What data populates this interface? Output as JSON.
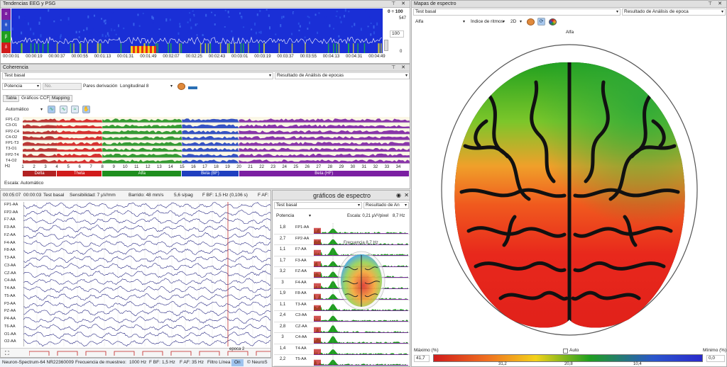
{
  "eeg_trends": {
    "title": "Tendencias EEG y PSG",
    "range_label": "0 ÷ 100",
    "scale_top": "547",
    "scale_value": "100",
    "scale_bottom": "0",
    "channels": [
      "α",
      "θ",
      "β",
      "δ"
    ],
    "time_labels": [
      "00:00:01",
      "00:00:19",
      "00:00:37",
      "00:00:55",
      "00:01:13",
      "00:01:31",
      "00:01:49",
      "00:02:07",
      "00:02:25",
      "00:02:43",
      "00:03:01",
      "00:03:19",
      "00:03:37",
      "00:03:55",
      "00:04:13",
      "00:04:31",
      "00:04:49"
    ]
  },
  "coherence": {
    "title": "Coherencia",
    "state_select": "Test basal",
    "result_select": "Resultado de Análisis de epocas",
    "measure_select": "Potencia",
    "no_input": "No.",
    "pairs_label": "Pares derivación:",
    "pairs_value": "Longitudinal 8",
    "tabs": [
      "Tabla",
      "Gráficos CCF",
      "Mapping"
    ],
    "auto_select": "Automático",
    "channels": [
      "FP1-C3",
      "C3-O1",
      "FP2-C4",
      "C4-O2",
      "FP1-T3",
      "T3-O1",
      "FP2-T4",
      "T4-O2"
    ],
    "hz_label": "Hz",
    "hz_ticks": [
      "1",
      "2",
      "3",
      "4",
      "5",
      "6",
      "7",
      "8",
      "9",
      "10",
      "11",
      "12",
      "13",
      "14",
      "15",
      "16",
      "17",
      "18",
      "19",
      "20",
      "21",
      "22",
      "23",
      "24",
      "25",
      "26",
      "27",
      "28",
      "29",
      "30",
      "31",
      "32",
      "33",
      "34"
    ],
    "bands": [
      {
        "name": "Delta",
        "color": "#b22222",
        "from": 1,
        "to": 4
      },
      {
        "name": "Theta",
        "color": "#d11b1b",
        "from": 4,
        "to": 8
      },
      {
        "name": "Alfa",
        "color": "#1f8f1f",
        "from": 8,
        "to": 15
      },
      {
        "name": "Beta (BF)",
        "color": "#1f3fbf",
        "from": 15,
        "to": 20
      },
      {
        "name": "Beta (HF)",
        "color": "#7b1fa2",
        "from": 20,
        "to": 35
      }
    ],
    "scale_text": "Escala: Automático"
  },
  "eeg_view": {
    "time_a": "00:05:07",
    "time_b": "00:00:03",
    "state": "Test basal",
    "sensitivity": "Sensibilidad: 7 µV/mm",
    "sweep": "Barrido: 48 mm/s",
    "page": "5,6 s/pag",
    "fbf": "F BF: 1,5 Hz (0,106 s)",
    "faf": "F AF:",
    "channels": [
      "FP1-AA",
      "FP2-AA",
      "F7-AA",
      "F3-AA",
      "FZ-AA",
      "F4-AA",
      "F8-AA",
      "T3-AA",
      "C3-AA",
      "CZ-AA",
      "C4-AA",
      "T4-AA",
      "T5-AA",
      "P3-AA",
      "PZ-AA",
      "P4-AA",
      "T6-AA",
      "O1-AA",
      "O2-AA"
    ],
    "epoch_label": "epoca 2"
  },
  "spectrum_graphs": {
    "title": "gráficos de espectro",
    "state": "Test basal",
    "result": "Resultado de An",
    "measure": "Potencia",
    "scale": "Escala: 0,21 µV²/pixel",
    "freq_value": "8,7 Hz",
    "freq_annot": "Frecuencia 8,7 Hz",
    "rows": [
      {
        "value": "1,8",
        "ch": "FP1-AA"
      },
      {
        "value": "2,7",
        "ch": "FP2-AA"
      },
      {
        "value": "1,1",
        "ch": "F7-AA"
      },
      {
        "value": "1,7",
        "ch": "F3-AA"
      },
      {
        "value": "3,2",
        "ch": "FZ-AA"
      },
      {
        "value": "3",
        "ch": "F4-AA"
      },
      {
        "value": "1,9",
        "ch": "F8-AA"
      },
      {
        "value": "1,1",
        "ch": "T3-AA"
      },
      {
        "value": "2,4",
        "ch": "C3-AA"
      },
      {
        "value": "2,8",
        "ch": "CZ-AA"
      },
      {
        "value": "3",
        "ch": "C4-AA"
      },
      {
        "value": "1,4",
        "ch": "T4-AA"
      },
      {
        "value": "2,2",
        "ch": "T5-AA"
      }
    ]
  },
  "spectrum_map": {
    "title": "Mapas de espectro",
    "state": "Test basal",
    "result": "Resultado de Análisis de epoca",
    "band_select": "Alfa",
    "index_select": "Índice de ritmos",
    "dim_select": "2D",
    "map_title": "Alfa",
    "max_label": "Máximo (%)",
    "auto_label": "Auto",
    "min_label": "Mínimo (%)",
    "max_value": "41,7",
    "min_value": "0,0",
    "scale_ticks": [
      "31,2",
      "20,8",
      "10,4"
    ]
  },
  "status": {
    "device": "Neuron-Spectrum-64 NR22360009",
    "sampling_label": "Frecuencia de muestreo:",
    "sampling_value": "1000 Hz",
    "fbf": "F BF:",
    "fbf_value": "1,5 Hz",
    "faf": "F AF:",
    "faf_value": "35 Hz",
    "line_filter": "Filtro Línea",
    "line_filter_state": "On",
    "brand": "© NeuroS"
  }
}
